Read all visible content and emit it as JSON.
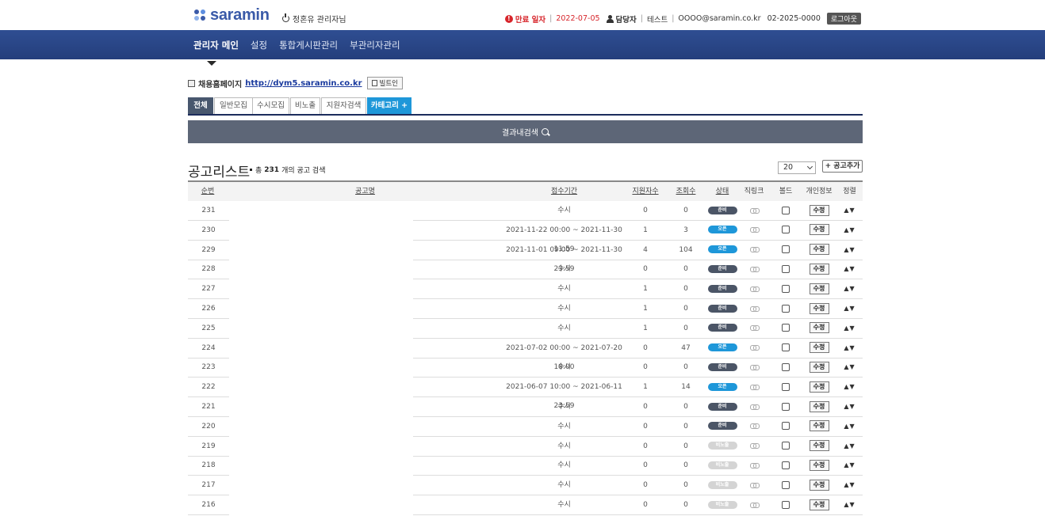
{
  "header": {
    "logo_text": "saramin",
    "user_label": "정혼유 관리자님",
    "expire_label": "만료 일자",
    "expire_date": "2022-07-05",
    "manager_label": "담당자",
    "manager_name": "테스트",
    "email": "OOOO@saramin.co.kr",
    "phone": "02-2025-0000",
    "logout_label": "로그아웃"
  },
  "nav": {
    "items": [
      "관리자 메인",
      "설정",
      "통합게시판관리",
      "부관리자관리"
    ]
  },
  "homepage": {
    "label": "채용홈페이지",
    "url": "http://dym5.saramin.co.kr",
    "build_label": "빌트인"
  },
  "tabs": [
    "전체",
    "일반모집",
    "수시모집",
    "비노출",
    "지원자검색",
    "카테고리 +"
  ],
  "search": {
    "label": "결과내검색"
  },
  "list": {
    "title": "공고리스트",
    "count_prefix": "총",
    "count": "231",
    "count_suffix": "개의 공고 검색",
    "page_size": "20",
    "add_label": "+ 공고추가"
  },
  "table": {
    "headers": [
      "순번",
      "공고명",
      "접수기간",
      "지원자수",
      "조회수",
      "상태",
      "직링크",
      "볼드",
      "개인정보",
      "정렬"
    ],
    "edit_label": "수정",
    "sort_label": "▲▼",
    "rows": [
      {
        "no": "231",
        "period": "수시",
        "applicants": "0",
        "views": "0",
        "status": "준비",
        "status_type": "prep"
      },
      {
        "no": "230",
        "period": "2021-11-22 00:00 ~ 2021-11-30 11:59",
        "applicants": "1",
        "views": "3",
        "status": "오픈",
        "status_type": "open"
      },
      {
        "no": "229",
        "period": "2021-11-01 09:00 ~ 2021-11-30 23:59",
        "applicants": "4",
        "views": "104",
        "status": "오픈",
        "status_type": "open"
      },
      {
        "no": "228",
        "period": "수시",
        "applicants": "0",
        "views": "0",
        "status": "준비",
        "status_type": "prep"
      },
      {
        "no": "227",
        "period": "수시",
        "applicants": "1",
        "views": "0",
        "status": "준비",
        "status_type": "prep"
      },
      {
        "no": "226",
        "period": "수시",
        "applicants": "1",
        "views": "0",
        "status": "준비",
        "status_type": "prep"
      },
      {
        "no": "225",
        "period": "수시",
        "applicants": "1",
        "views": "0",
        "status": "준비",
        "status_type": "prep"
      },
      {
        "no": "224",
        "period": "2021-07-02 00:00 ~ 2021-07-20 18:00",
        "applicants": "0",
        "views": "47",
        "status": "오픈",
        "status_type": "open"
      },
      {
        "no": "223",
        "period": "수시",
        "applicants": "0",
        "views": "0",
        "status": "준비",
        "status_type": "prep"
      },
      {
        "no": "222",
        "period": "2021-06-07 10:00 ~ 2021-06-11 23:59",
        "applicants": "1",
        "views": "14",
        "status": "오픈",
        "status_type": "open"
      },
      {
        "no": "221",
        "period": "수시",
        "applicants": "0",
        "views": "0",
        "status": "준비",
        "status_type": "prep"
      },
      {
        "no": "220",
        "period": "수시",
        "applicants": "0",
        "views": "0",
        "status": "준비",
        "status_type": "prep"
      },
      {
        "no": "219",
        "period": "수시",
        "applicants": "0",
        "views": "0",
        "status": "비노출",
        "status_type": "hide"
      },
      {
        "no": "218",
        "period": "수시",
        "applicants": "0",
        "views": "0",
        "status": "비노출",
        "status_type": "hide"
      },
      {
        "no": "217",
        "period": "수시",
        "applicants": "0",
        "views": "0",
        "status": "비노출",
        "status_type": "hide"
      },
      {
        "no": "216",
        "period": "수시",
        "applicants": "0",
        "views": "0",
        "status": "비노출",
        "status_type": "hide"
      }
    ]
  },
  "colors": {
    "nav_bg": "#2a4686",
    "accent_blue": "#1e97d9",
    "alert_red": "#d7252b",
    "prep_badge": "#4b5566",
    "hide_badge": "#d4d4d4"
  }
}
